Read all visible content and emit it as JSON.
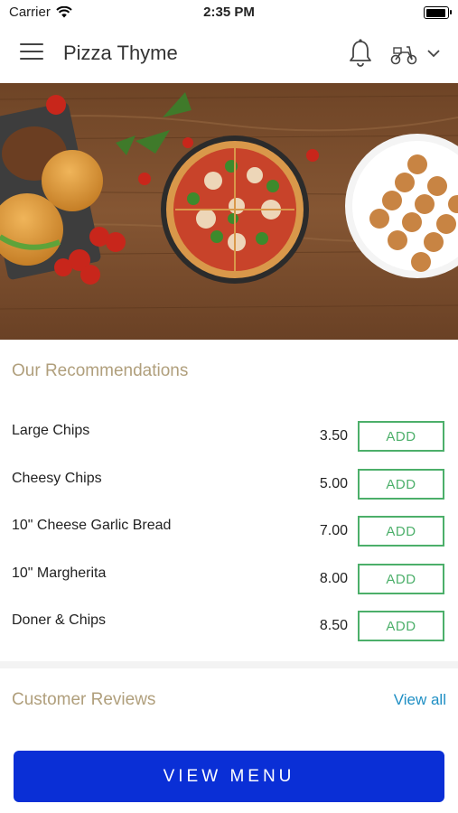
{
  "status_bar": {
    "carrier": "Carrier",
    "time": "2:35 PM"
  },
  "header": {
    "title": "Pizza Thyme"
  },
  "recommendations": {
    "title": "Our Recommendations",
    "add_label": "ADD",
    "items": [
      {
        "name": "Large Chips",
        "price": "3.50"
      },
      {
        "name": "Cheesy Chips",
        "price": "5.00"
      },
      {
        "name": "10\" Cheese Garlic Bread",
        "price": "7.00"
      },
      {
        "name": "10\" Margherita",
        "price": "8.00"
      },
      {
        "name": "Doner & Chips",
        "price": "8.50"
      }
    ]
  },
  "reviews": {
    "title": "Customer Reviews",
    "view_all": "View all"
  },
  "footer": {
    "view_menu": "VIEW MENU"
  },
  "colors": {
    "accent_gold": "#b09f7c",
    "add_green": "#4caf6a",
    "link_blue": "#1f8fc4",
    "primary_blue": "#0a2fd6",
    "wood": "#7a4f2e"
  }
}
